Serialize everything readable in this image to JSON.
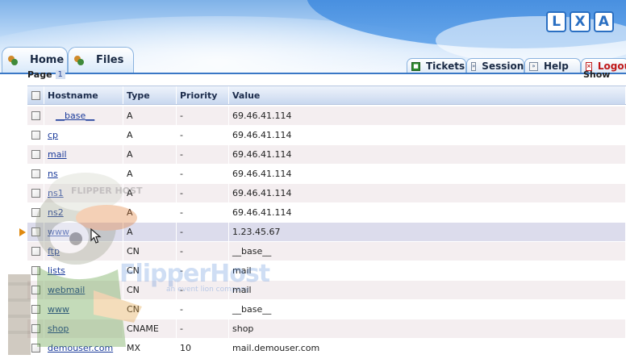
{
  "header": {
    "logo_letters": [
      "L",
      "X",
      "A"
    ]
  },
  "tabs_left": [
    {
      "label": "Home"
    },
    {
      "label": "Files"
    }
  ],
  "tabs_right": [
    {
      "label": "Tickets"
    },
    {
      "label": "Session"
    },
    {
      "label": "Help"
    },
    {
      "label": "Logou"
    }
  ],
  "pager": {
    "label": "Page",
    "current": "1"
  },
  "show_label": "Show",
  "table": {
    "columns": [
      "Hostname",
      "Type",
      "Priority",
      "Value"
    ],
    "rows": [
      {
        "hostname": "__base__",
        "type": "A",
        "priority": "-",
        "value": "69.46.41.114"
      },
      {
        "hostname": "cp",
        "type": "A",
        "priority": "-",
        "value": "69.46.41.114"
      },
      {
        "hostname": "mail",
        "type": "A",
        "priority": "-",
        "value": "69.46.41.114"
      },
      {
        "hostname": "ns",
        "type": "A",
        "priority": "-",
        "value": "69.46.41.114"
      },
      {
        "hostname": "ns1",
        "type": "A",
        "priority": "-",
        "value": "69.46.41.114"
      },
      {
        "hostname": "ns2",
        "type": "A",
        "priority": "-",
        "value": "69.46.41.114"
      },
      {
        "hostname": "www",
        "type": "A",
        "priority": "-",
        "value": "1.23.45.67"
      },
      {
        "hostname": "ftp",
        "type": "CN",
        "priority": "-",
        "value": "__base__"
      },
      {
        "hostname": "lists",
        "type": "CN",
        "priority": "-",
        "value": "mail"
      },
      {
        "hostname": "webmail",
        "type": "CN",
        "priority": "-",
        "value": "mail"
      },
      {
        "hostname": "www",
        "type": "CN",
        "priority": "-",
        "value": "__base__"
      },
      {
        "hostname": "shop",
        "type": "CNAME",
        "priority": "-",
        "value": "shop"
      },
      {
        "hostname": "demouser.com",
        "type": "MX",
        "priority": "10",
        "value": "mail.demouser.com"
      }
    ]
  },
  "watermark": {
    "brand": "FlipperHost",
    "tagline": "an event lion company",
    "cap_text": "FLIPPER HOST"
  },
  "colors": {
    "accent": "#3a78c6",
    "link": "#1a3a9a",
    "logout": "#c01818",
    "pointer": "#e08a10"
  }
}
